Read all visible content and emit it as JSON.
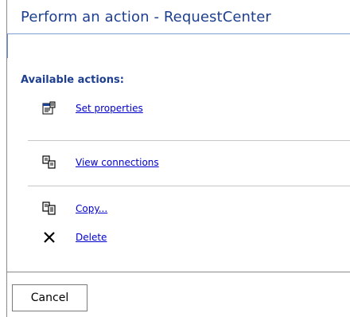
{
  "window": {
    "title": "Perform an action - RequestCenter"
  },
  "actions_heading": "Available actions:",
  "actions": [
    {
      "label": "Set properties",
      "icon": "properties-icon"
    },
    {
      "label": "View connections",
      "icon": "connections-icon"
    },
    {
      "label": "Copy...",
      "icon": "copy-icon"
    },
    {
      "label": "Delete",
      "icon": "delete-icon"
    }
  ],
  "footer": {
    "cancel_label": "Cancel"
  },
  "colors": {
    "title": "#1e3f8f",
    "link": "#0000cc",
    "separator": "#c8c8c8"
  }
}
